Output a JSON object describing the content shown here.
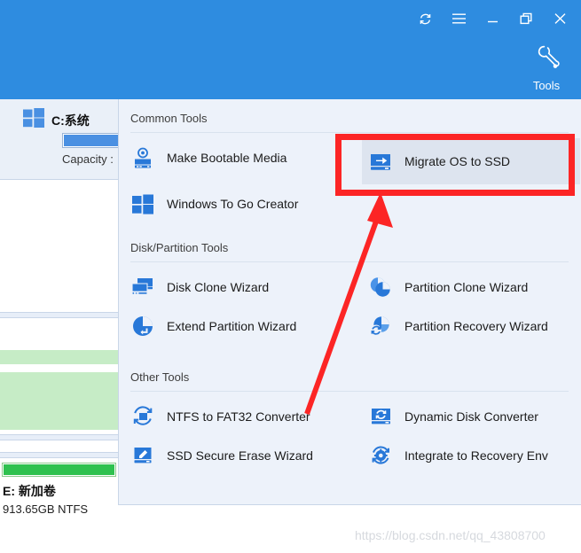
{
  "header": {
    "window_controls": [
      {
        "name": "refresh",
        "label": "Refresh"
      },
      {
        "name": "menu",
        "label": "Menu"
      },
      {
        "name": "minimize",
        "label": "Minimize"
      },
      {
        "name": "restore",
        "label": "Restore"
      },
      {
        "name": "close",
        "label": "Close"
      }
    ],
    "tools_label": "Tools",
    "accent_color": "#2e8ce0"
  },
  "sidebar": {
    "disk": {
      "title": "C:系统",
      "capacity_label": "Capacity :",
      "usage_percent": 100,
      "bar_color": "#4a90e2"
    },
    "volume": {
      "title": "E: 新加卷",
      "subtitle": "913.65GB NTFS",
      "fill_percent": 100,
      "bar_color": "#2fc14f",
      "band_color": "#c6ecc6"
    }
  },
  "tools_panel": {
    "sections": [
      {
        "title": "Common Tools",
        "items": [
          {
            "label": "Make Bootable Media",
            "icon": "bootable-media-icon",
            "selected": false
          },
          {
            "label": "Migrate OS to SSD",
            "icon": "migrate-os-icon",
            "selected": true
          },
          {
            "label": "Windows To Go Creator",
            "icon": "windows-logo-icon",
            "selected": false
          }
        ]
      },
      {
        "title": "Disk/Partition Tools",
        "items": [
          {
            "label": "Disk Clone Wizard",
            "icon": "disk-clone-icon",
            "selected": false
          },
          {
            "label": "Partition Clone Wizard",
            "icon": "partition-clone-icon",
            "selected": false
          },
          {
            "label": "Extend Partition Wizard",
            "icon": "extend-partition-icon",
            "selected": false
          },
          {
            "label": "Partition Recovery Wizard",
            "icon": "partition-recovery-icon",
            "selected": false
          }
        ]
      },
      {
        "title": "Other Tools",
        "items": [
          {
            "label": "NTFS to FAT32 Converter",
            "icon": "ntfs-convert-icon",
            "selected": false
          },
          {
            "label": "Dynamic Disk Converter",
            "icon": "dynamic-disk-icon",
            "selected": false
          },
          {
            "label": "SSD Secure Erase Wizard",
            "icon": "ssd-erase-icon",
            "selected": false
          },
          {
            "label": "Integrate to Recovery Env",
            "icon": "recovery-env-icon",
            "selected": false
          }
        ]
      }
    ]
  },
  "annotation": {
    "color": "#fc2525",
    "highlight_target": "Migrate OS to SSD"
  },
  "watermark": {
    "text": "https://blog.csdn.net/qq_43808700"
  }
}
